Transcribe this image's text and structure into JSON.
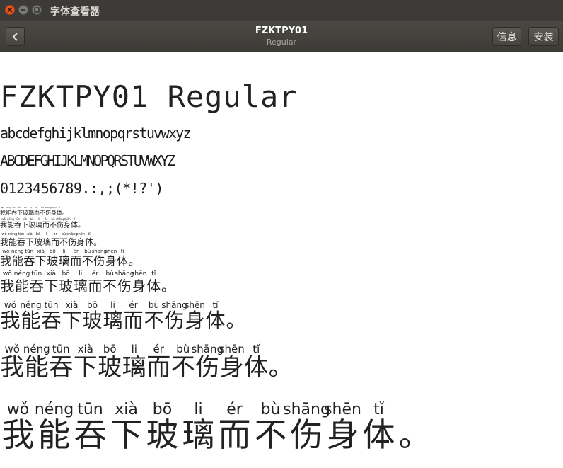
{
  "window": {
    "title": "字体查看器"
  },
  "header": {
    "font_name": "FZKTPY01",
    "font_style": "Regular",
    "info_label": "信息",
    "install_label": "安装"
  },
  "preview": {
    "name_line": "FZKTPY01 Regular",
    "lowercase": "abcdefghijklmnopqrstuvwxyz",
    "uppercase": "ABCDEFGHIJKLMNOPQRSTUVWXYZ",
    "digits": "0123456789.:,;(*!?')",
    "sample_chars": [
      "我",
      "能",
      "吞",
      "下",
      "玻",
      "璃",
      "而",
      "不",
      "伤",
      "身",
      "体",
      "。"
    ],
    "sample_pinyin": [
      "wǒ",
      "néng",
      "tūn",
      "xià",
      "bō",
      "li",
      "ér",
      "bù",
      "shāng",
      "shēn",
      "tǐ",
      ""
    ]
  }
}
